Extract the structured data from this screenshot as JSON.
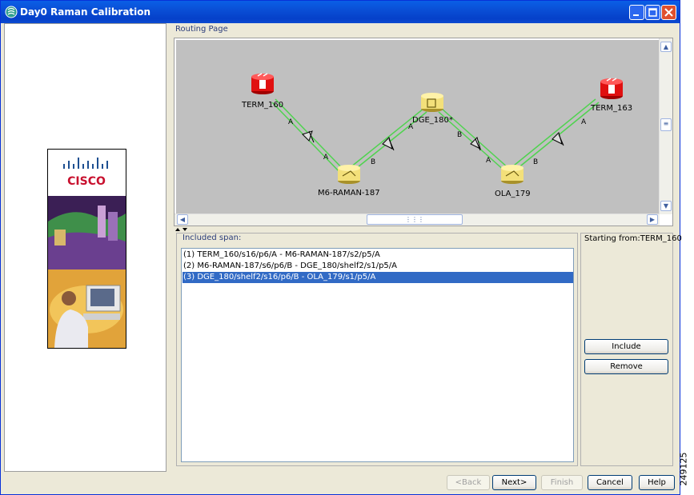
{
  "window": {
    "title": "Day0 Raman Calibration",
    "title_bar_color": "#0a4fd6"
  },
  "left_panel": {
    "logo_text": "CISCO"
  },
  "routing": {
    "label": "Routing Page",
    "map_background": "#c0c0c0",
    "link_color": "#4fd34f",
    "nodes": [
      {
        "id": "TERM_160",
        "label": "TERM_160",
        "kind": "terminal",
        "color": "#e01010"
      },
      {
        "id": "M6-RAMAN-187",
        "label": "M6-RAMAN-187",
        "kind": "amplifier",
        "color": "#f3e07a"
      },
      {
        "id": "DGE_180",
        "label": "DGE_180*",
        "kind": "dge",
        "color": "#f3e07a"
      },
      {
        "id": "OLA_179",
        "label": "OLA_179",
        "kind": "amplifier",
        "color": "#f3e07a"
      },
      {
        "id": "TERM_163",
        "label": "TERM_163",
        "kind": "terminal",
        "color": "#e01010"
      }
    ],
    "edge_labels": {
      "term160_a": "A",
      "m6_a": "A",
      "m6_b": "B",
      "dge_a": "A",
      "dge_b": "B",
      "ola_a": "A",
      "ola_b": "B",
      "term163_a": "A"
    }
  },
  "spans": {
    "title": "Included span:",
    "items": [
      {
        "text": "(1) TERM_160/s16/p6/A - M6-RAMAN-187/s2/p5/A",
        "selected": false
      },
      {
        "text": "(2) M6-RAMAN-187/s6/p6/B - DGE_180/shelf2/s1/p5/A",
        "selected": false
      },
      {
        "text": "(3) DGE_180/shelf2/s16/p6/B - OLA_179/s1/p5/A",
        "selected": true
      }
    ],
    "selection_color": "#316ac5"
  },
  "side": {
    "starting_from": "Starting from:TERM_160",
    "include_label": "Include",
    "remove_label": "Remove"
  },
  "footer": {
    "back_label": "<Back",
    "next_label": "Next>",
    "finish_label": "Finish",
    "cancel_label": "Cancel",
    "help_label": "Help"
  },
  "watermark": "249125"
}
